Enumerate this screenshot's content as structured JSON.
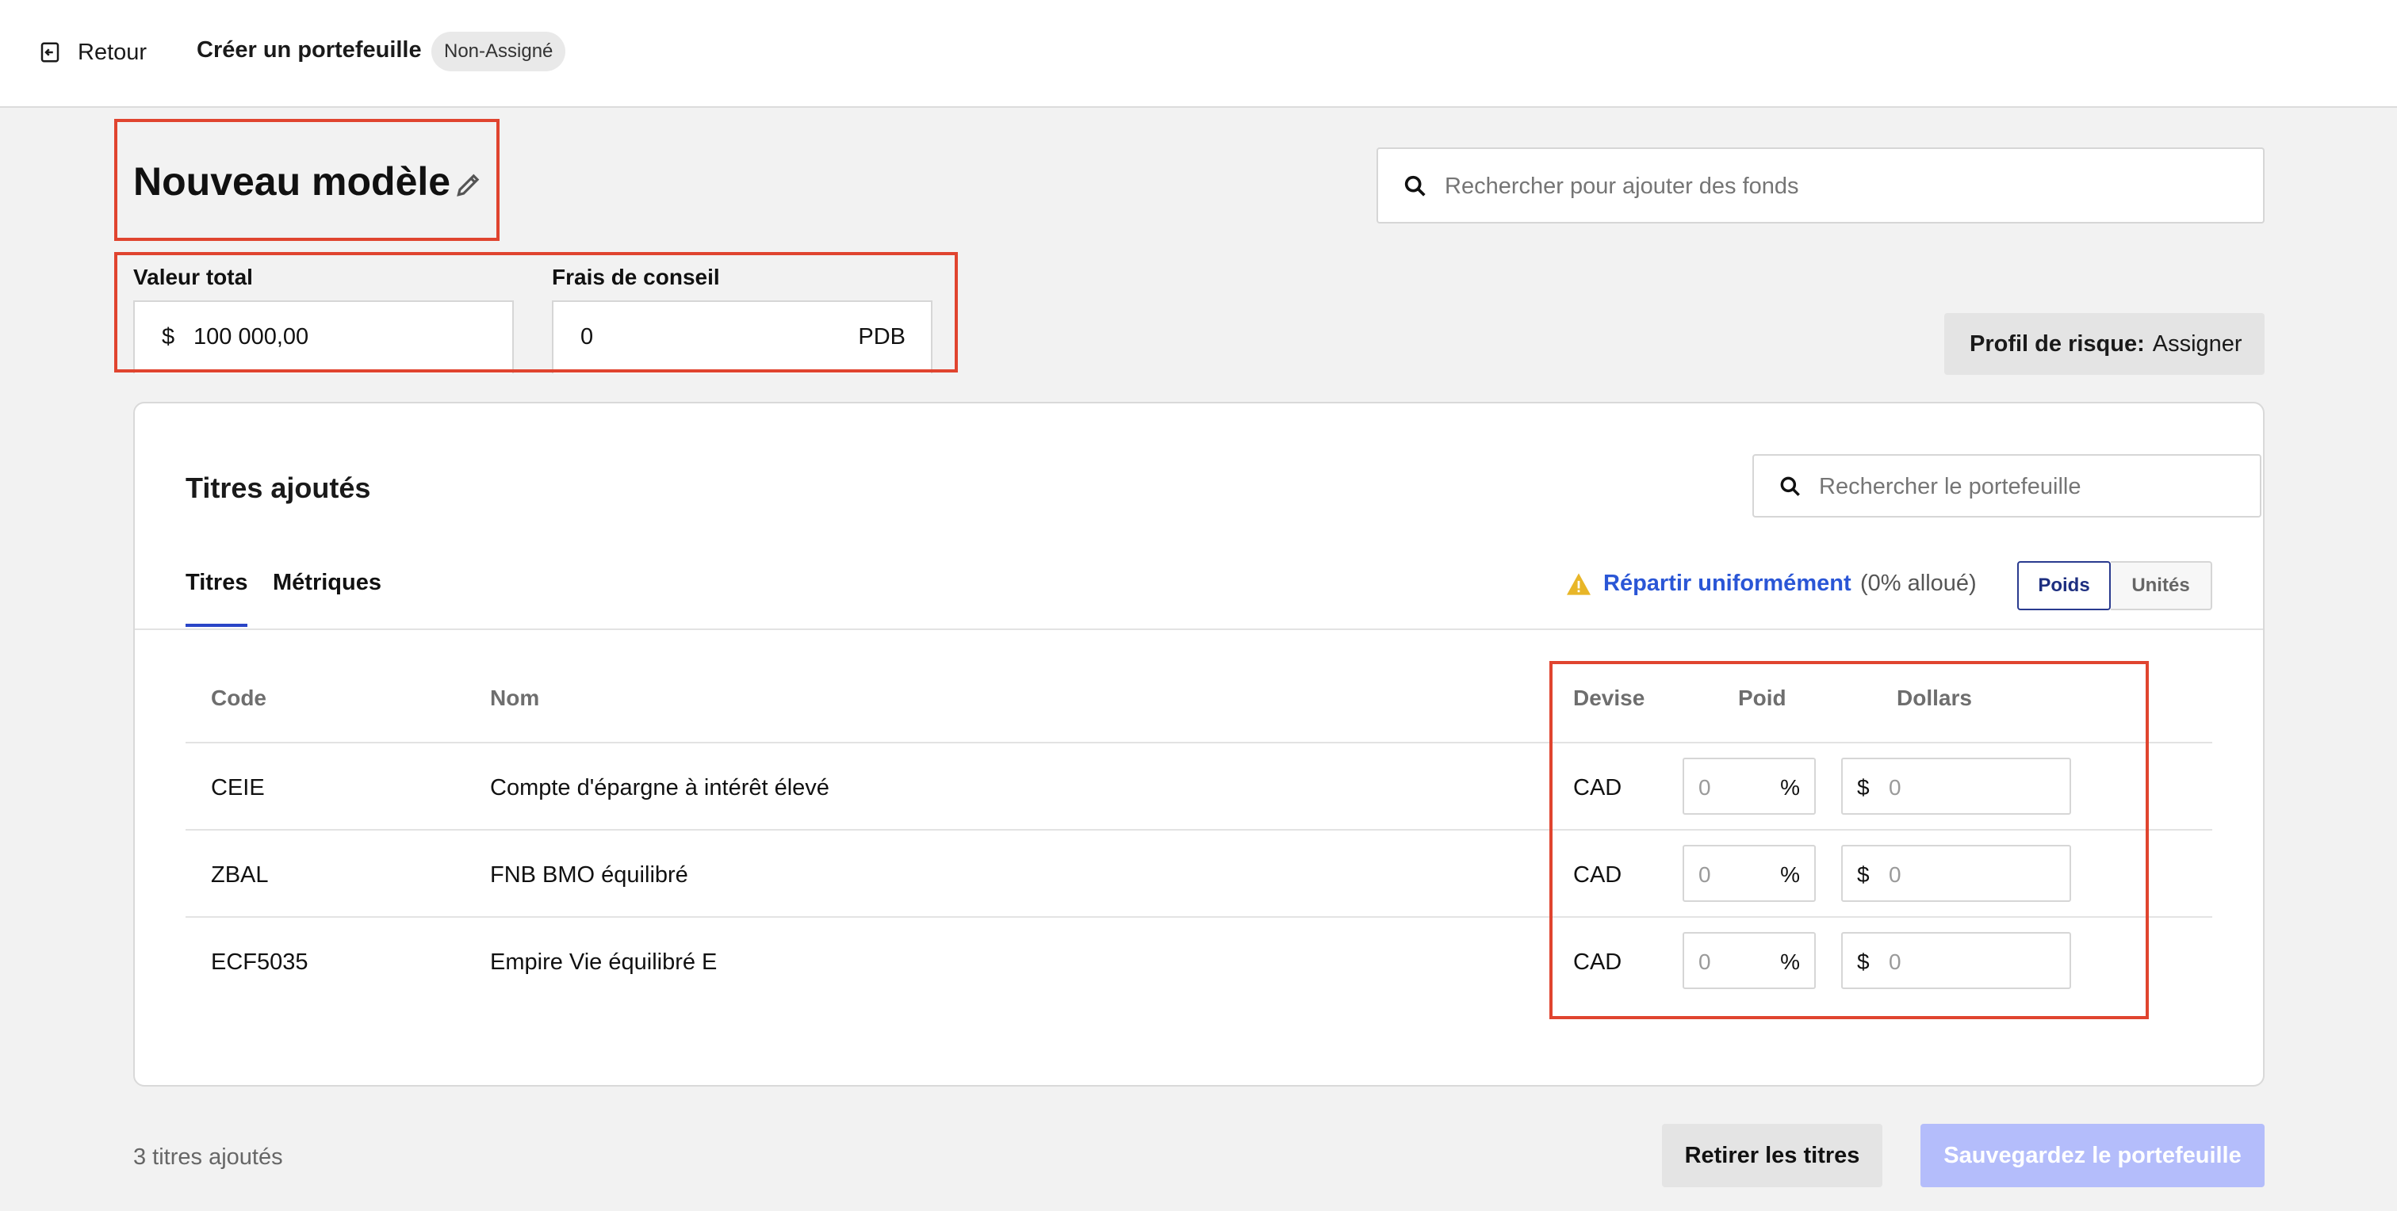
{
  "topbar": {
    "back_label": "Retour",
    "title": "Créer un portefeuille",
    "status_badge": "Non-Assigné"
  },
  "model": {
    "name": "Nouveau modèle"
  },
  "fund_search": {
    "placeholder": "Rechercher pour ajouter des fonds"
  },
  "total_value": {
    "label": "Valeur total",
    "currency_symbol": "$",
    "value": "100 000,00"
  },
  "advisory_fee": {
    "label": "Frais de conseil",
    "value": "0",
    "unit": "PDB"
  },
  "risk_profile": {
    "label": "Profil de risque:",
    "value": "Assigner"
  },
  "holdings": {
    "title": "Titres ajoutés",
    "search_placeholder": "Rechercher le portefeuille",
    "tabs": [
      "Titres",
      "Métriques"
    ],
    "active_tab": "Titres",
    "distribute_label": "Répartir uniformément",
    "allocation_status": "(0% alloué)",
    "mode_toggle": {
      "weight": "Poids",
      "units": "Unités",
      "selected": "Poids"
    },
    "columns": {
      "code": "Code",
      "name": "Nom",
      "currency": "Devise",
      "weight": "Poid",
      "dollars": "Dollars"
    },
    "rows": [
      {
        "code": "CEIE",
        "name": "Compte d'épargne à intérêt élevé",
        "currency": "CAD",
        "weight_placeholder": "0",
        "weight_unit": "%",
        "dollar_symbol": "$",
        "dollar_placeholder": "0"
      },
      {
        "code": "ZBAL",
        "name": "FNB BMO équilibré",
        "currency": "CAD",
        "weight_placeholder": "0",
        "weight_unit": "%",
        "dollar_symbol": "$",
        "dollar_placeholder": "0"
      },
      {
        "code": "ECF5035",
        "name": "Empire Vie équilibré E",
        "currency": "CAD",
        "weight_placeholder": "0",
        "weight_unit": "%",
        "dollar_symbol": "$",
        "dollar_placeholder": "0"
      }
    ]
  },
  "footer": {
    "count_text": "3 titres ajoutés",
    "remove_button": "Retirer les titres",
    "save_button": "Sauvegardez le portefeuille"
  },
  "colors": {
    "accent_blue": "#2a56d6",
    "annotation_red": "#e0442f",
    "warning_yellow": "#e8b628",
    "save_disabled": "#b4bdfb"
  },
  "icons": {
    "back": "exit-arrow-icon",
    "edit": "pencil-icon",
    "search": "search-icon",
    "warning": "warning-triangle-icon"
  }
}
